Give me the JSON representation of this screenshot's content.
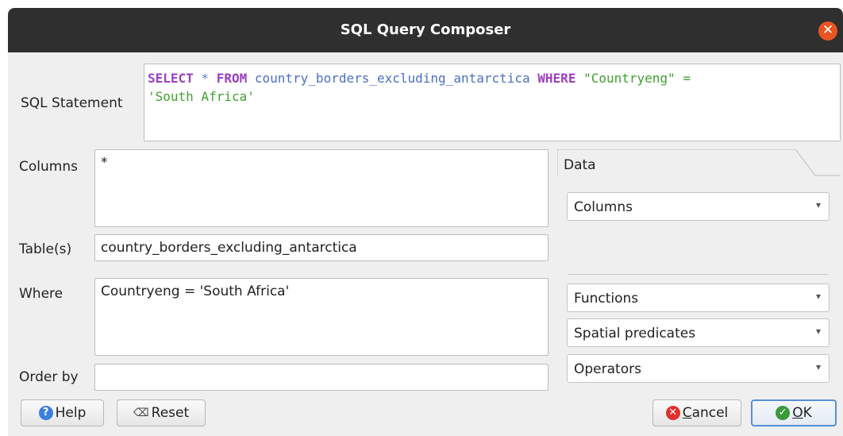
{
  "window": {
    "title": "SQL Query Composer",
    "close_glyph": "✕"
  },
  "sql_statement": {
    "label": "SQL Statement",
    "line1": {
      "select": "SELECT",
      "star": " * ",
      "from": "FROM",
      "table": " country_borders_excluding_antarctica ",
      "where": "WHERE",
      "column": " \"Countryeng\" =",
      "eq": ""
    },
    "line2": "'South Africa'"
  },
  "columns": {
    "label": "Columns",
    "value": "*"
  },
  "tables": {
    "label": "Table(s)",
    "value": "country_borders_excluding_antarctica"
  },
  "where": {
    "label": "Where",
    "value": "Countryeng = 'South Africa'"
  },
  "order_by": {
    "label": "Order by",
    "value": ""
  },
  "data_tab": {
    "label": "Data",
    "columns_combo": "Columns",
    "functions_combo": "Functions",
    "spatial_combo": "Spatial predicates",
    "operators_combo": "Operators"
  },
  "buttons": {
    "help": "Help",
    "reset": "Reset",
    "cancel_prefix": "",
    "cancel_underlined": "C",
    "cancel_rest": "ancel",
    "ok_underlined": "O",
    "ok_rest": "K"
  },
  "icons": {
    "help": "help-icon",
    "reset": "backspace-icon",
    "cancel": "cancel-icon",
    "ok": "ok-check-icon"
  },
  "colors": {
    "keyword": "#9b3fbf",
    "identifier": "#4a6fc8",
    "string": "#3f9f2f",
    "titlebar": "#2f2f2f",
    "close": "#e95420"
  }
}
